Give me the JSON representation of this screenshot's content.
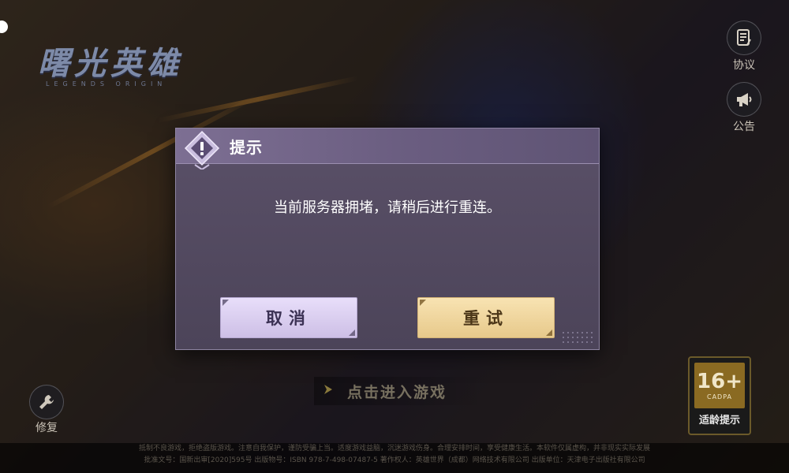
{
  "brand": {
    "logo_text": "曙光英雄",
    "logo_subtext": "LEGENDS ORIGIN"
  },
  "side_buttons": {
    "agreement_label": "协议",
    "announcement_label": "公告"
  },
  "repair": {
    "label": "修复"
  },
  "enter_game": {
    "label": "点击进入游戏"
  },
  "age_rating": {
    "number": "16+",
    "org": "CADPA",
    "label": "适龄提示"
  },
  "footer": {
    "line1": "抵制不良游戏，拒绝盗版游戏。注意自我保护，谨防受骗上当。适度游戏益脑，沉迷游戏伤身。合理安排时间，享受健康生活。本软件仅属虚构，并非现实实际发展",
    "line2": "批准文号：国新出审[2020]595号  出版物号：ISBN 978-7-498-07487-5  著作权人：英雄世界（成都）网络技术有限公司  出版单位：天津电子出版社有限公司"
  },
  "dialog": {
    "title": "提示",
    "message": "当前服务器拥堵，请稍后进行重连。",
    "cancel_label": "取消",
    "retry_label": "重试"
  },
  "colors": {
    "dialog_bg": "#4c4459",
    "dialog_header": "#7d6f93",
    "cancel_bg": "#e8defa",
    "retry_bg": "#f8e3b2"
  },
  "icons": {
    "agreement": "document-icon",
    "announcement": "megaphone-icon",
    "repair": "wrench-icon",
    "enter": "chevron-right-icon",
    "dialog": "warning-icon"
  }
}
